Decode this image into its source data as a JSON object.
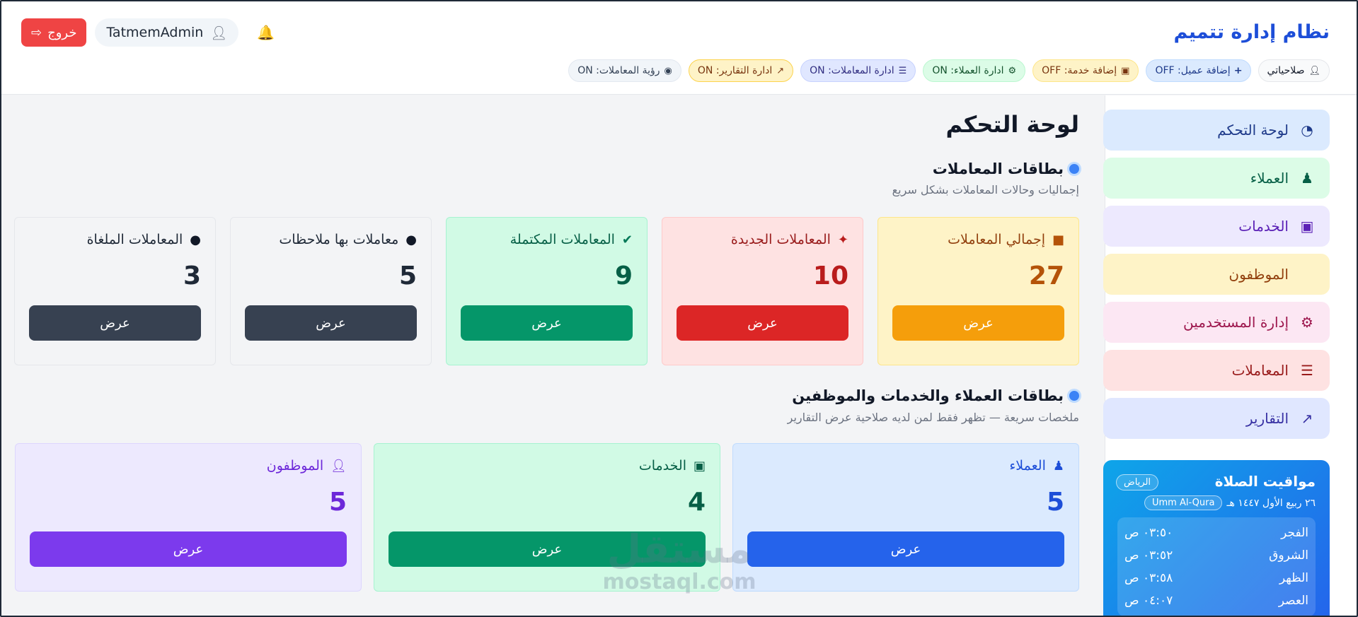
{
  "header": {
    "brand": "نظام إدارة تتميم",
    "logout_label": "خروج",
    "username": "TatmemAdmin"
  },
  "permissions": {
    "title": "صلاحياتي",
    "items": [
      {
        "label": "إضافة عميل: OFF",
        "icon": "user-plus-icon"
      },
      {
        "label": "إضافة خدمة: OFF",
        "icon": "briefcase-plus-icon"
      },
      {
        "label": "ادارة العملاء: ON",
        "icon": "user-gear-icon"
      },
      {
        "label": "ادارة المعاملات: ON",
        "icon": "list-check-icon"
      },
      {
        "label": "ادارة التقارير: ON",
        "icon": "chart-line-icon"
      },
      {
        "label": "رؤية المعاملات: ON",
        "icon": "eye-icon"
      }
    ]
  },
  "sidebar": {
    "items": [
      {
        "label": "لوحة التحكم",
        "icon": "gauge-icon"
      },
      {
        "label": "العملاء",
        "icon": "users-icon"
      },
      {
        "label": "الخدمات",
        "icon": "briefcase-icon"
      },
      {
        "label": "الموظفون",
        "icon": ""
      },
      {
        "label": "إدارة المستخدمين",
        "icon": "user-gear-icon"
      },
      {
        "label": "المعاملات",
        "icon": "list-check-icon"
      },
      {
        "label": "التقارير",
        "icon": "chart-line-icon"
      }
    ]
  },
  "prayer": {
    "title": "مواقيت الصلاة",
    "city": "الرياض",
    "hijri_date": "٢٦ ربيع الأول ١٤٤٧ هـ",
    "calendar": "Umm Al-Qura",
    "times": [
      {
        "name": "الفجر",
        "time": "٠٣:٥٠ ص"
      },
      {
        "name": "الشروق",
        "time": "٠٣:٥٢ ص"
      },
      {
        "name": "الظهر",
        "time": "٠٣:٥٨ ص"
      },
      {
        "name": "العصر",
        "time": "٠٤:٠٧ ص"
      }
    ]
  },
  "main": {
    "page_title": "لوحة التحكم",
    "transactions_section": {
      "title": "بطاقات المعاملات",
      "subtitle": "إجماليات وحالات المعاملات بشكل سريع",
      "cards": [
        {
          "title": "إجمالي المعاملات",
          "value": "27",
          "button": "عرض",
          "color": "#b45309",
          "button_color": "#f59e0b"
        },
        {
          "title": "المعاملات الجديدة",
          "value": "10",
          "button": "عرض",
          "color": "#b91c1c",
          "button_color": "#dc2626"
        },
        {
          "title": "المعاملات المكتملة",
          "value": "9",
          "button": "عرض",
          "color": "#065f46",
          "button_color": "#059669"
        },
        {
          "title": "معاملات بها ملاحظات",
          "value": "5",
          "button": "عرض",
          "color": "#1f2937",
          "button_color": "#374151"
        },
        {
          "title": "المعاملات الملغاة",
          "value": "3",
          "button": "عرض",
          "color": "#1f2937",
          "button_color": "#374151"
        }
      ]
    },
    "summary_section": {
      "title": "بطاقات العملاء والخدمات والموظفين",
      "subtitle": "ملخصات سريعة — تظهر فقط لمن لديه صلاحية عرض التقارير",
      "cards": [
        {
          "title": "العملاء",
          "value": "5",
          "button": "عرض",
          "color": "#1d4ed8",
          "button_color": "#2563eb"
        },
        {
          "title": "الخدمات",
          "value": "4",
          "button": "عرض",
          "color": "#065f46",
          "button_color": "#059669"
        },
        {
          "title": "الموظفون",
          "value": "5",
          "button": "عرض",
          "color": "#6d28d9",
          "button_color": "#7c3aed"
        }
      ]
    }
  },
  "watermark": {
    "arabic": "مستقل",
    "latin": "mostaql.com"
  }
}
